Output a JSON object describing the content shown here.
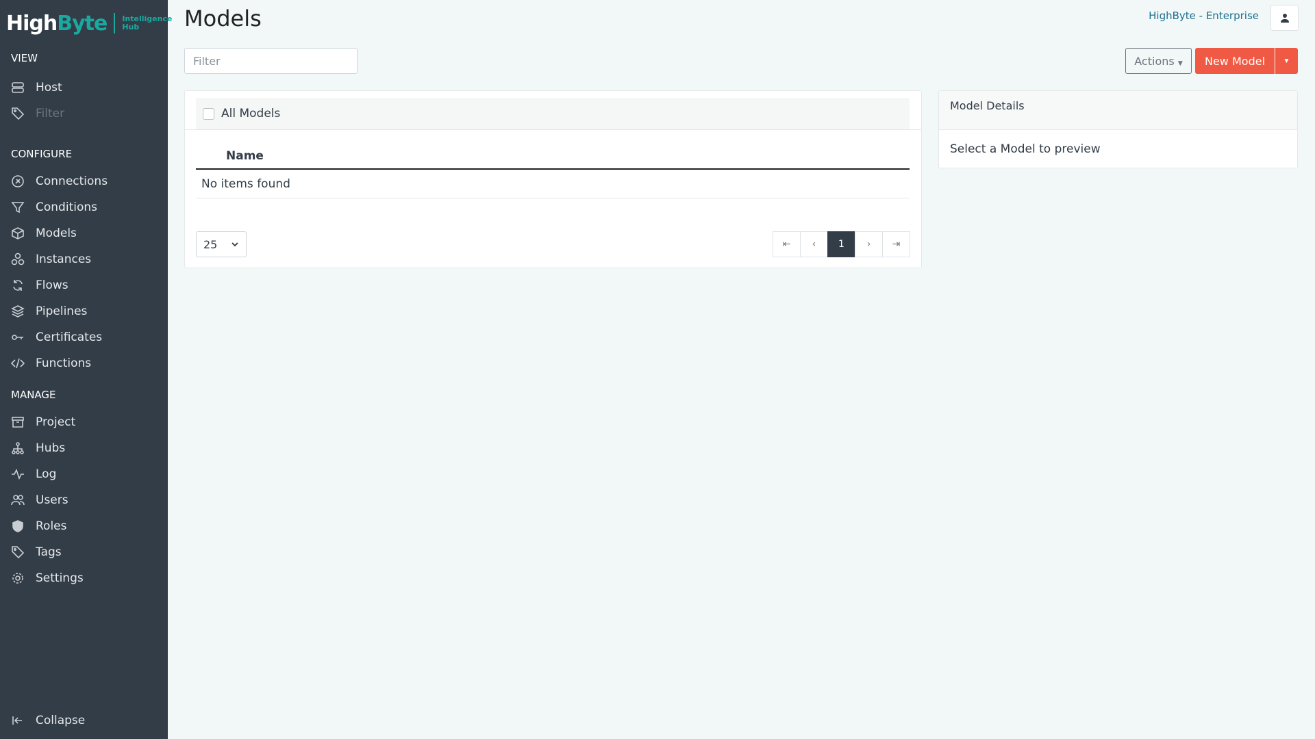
{
  "brand": {
    "logo_main": "HighByte",
    "logo_sub1": "Intelligence",
    "logo_sub2": "Hub"
  },
  "sidebar": {
    "sections": {
      "view": "VIEW",
      "configure": "CONFIGURE",
      "manage": "MANAGE"
    },
    "view_items": [
      {
        "label": "Host",
        "icon": "server-icon"
      },
      {
        "label": "Filter",
        "icon": "tag-icon"
      }
    ],
    "configure_items": [
      {
        "label": "Connections",
        "icon": "plug-icon"
      },
      {
        "label": "Conditions",
        "icon": "funnel-icon"
      },
      {
        "label": "Models",
        "icon": "cube-icon"
      },
      {
        "label": "Instances",
        "icon": "cubes-icon"
      },
      {
        "label": "Flows",
        "icon": "sync-icon"
      },
      {
        "label": "Pipelines",
        "icon": "layers-icon"
      },
      {
        "label": "Certificates",
        "icon": "key-icon"
      },
      {
        "label": "Functions",
        "icon": "code-icon"
      }
    ],
    "manage_items": [
      {
        "label": "Project",
        "icon": "archive-icon"
      },
      {
        "label": "Hubs",
        "icon": "sitemap-icon"
      },
      {
        "label": "Log",
        "icon": "pulse-icon"
      },
      {
        "label": "Users",
        "icon": "users-icon"
      },
      {
        "label": "Roles",
        "icon": "shield-icon"
      },
      {
        "label": "Tags",
        "icon": "tags-icon"
      },
      {
        "label": "Settings",
        "icon": "gear-icon"
      }
    ],
    "collapse": "Collapse"
  },
  "header": {
    "title": "Models",
    "account": "HighByte - Enterprise",
    "filter_placeholder": "Filter"
  },
  "toolbar": {
    "actions": "Actions",
    "new_model": "New Model"
  },
  "list": {
    "all_label": "All Models",
    "column": "Name",
    "empty": "No items found",
    "page_size": "25",
    "current_page": "1"
  },
  "details": {
    "title": "Model Details",
    "empty": "Select a Model to preview"
  },
  "colors": {
    "sidebar": "#333d47",
    "accent": "#f05a44",
    "brand": "#1aa9a0"
  }
}
